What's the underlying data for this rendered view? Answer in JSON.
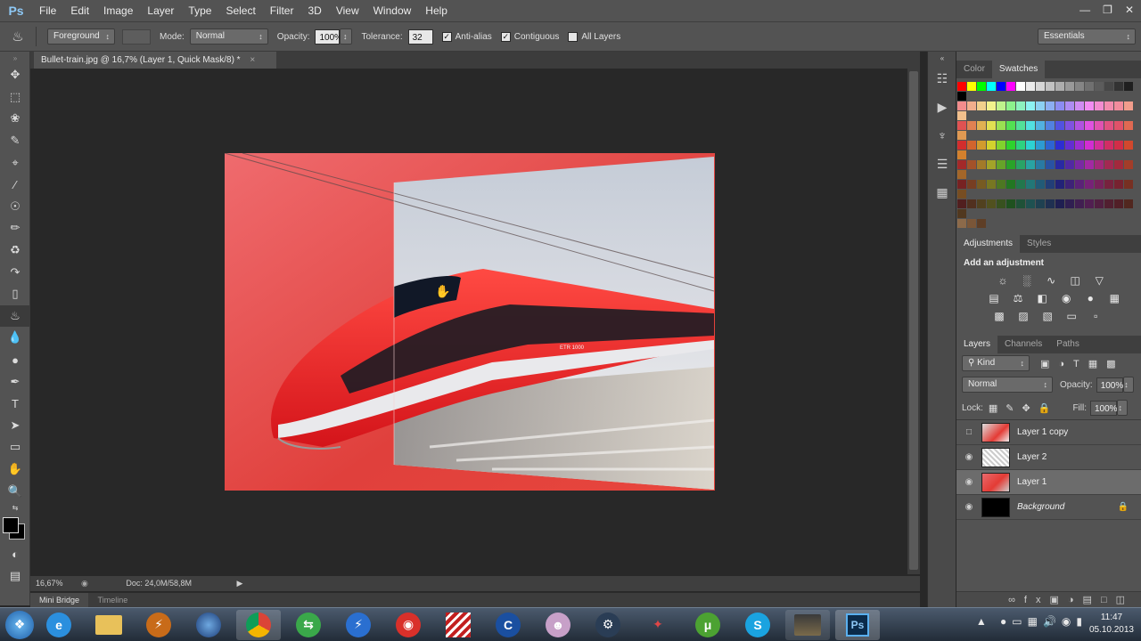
{
  "app": {
    "logo": "Ps"
  },
  "menu": [
    "File",
    "Edit",
    "Image",
    "Layer",
    "Type",
    "Select",
    "Filter",
    "3D",
    "View",
    "Window",
    "Help"
  ],
  "window_controls": {
    "minimize": "—",
    "restore": "❐",
    "close": "✕"
  },
  "options": {
    "tool_icon": "paint-bucket-icon",
    "fill_source": "Foreground",
    "mode_label": "Mode:",
    "mode": "Normal",
    "opacity_label": "Opacity:",
    "opacity": "100%",
    "tolerance_label": "Tolerance:",
    "tolerance": "32",
    "antialias": "Anti-alias",
    "contiguous": "Contiguous",
    "all_layers": "All Layers",
    "workspace": "Essentials"
  },
  "document": {
    "tab_title": "Bullet-train.jpg @ 16,7% (Layer 1, Quick Mask/8) *",
    "close": "×",
    "zoom": "16,67%",
    "doc_size": "Doc: 24,0M/58,8M",
    "artwork_text": {
      "train_label": "ETR 1000"
    }
  },
  "bottom_tabs": [
    "Mini Bridge",
    "Timeline"
  ],
  "color_panel": {
    "tabs": [
      "Color",
      "Swatches"
    ],
    "active": "Swatches"
  },
  "adjustments_panel": {
    "tabs": [
      "Adjustments",
      "Styles"
    ],
    "heading": "Add an adjustment"
  },
  "layers_panel": {
    "tabs": [
      "Layers",
      "Channels",
      "Paths"
    ],
    "kind": "Kind",
    "blend_mode": "Normal",
    "opacity_label": "Opacity:",
    "opacity": "100%",
    "lock_label": "Lock:",
    "fill_label": "Fill:",
    "fill": "100%",
    "layers": [
      {
        "name": "Layer 1 copy",
        "visible": false,
        "selected": false
      },
      {
        "name": "Layer 2",
        "visible": true,
        "selected": false
      },
      {
        "name": "Layer 1",
        "visible": true,
        "selected": true
      },
      {
        "name": "Background",
        "visible": true,
        "selected": false,
        "locked": true
      }
    ]
  },
  "taskbar": {
    "time": "11:47",
    "date": "05.10.2013",
    "apps": [
      "start-orb",
      "internet-explorer",
      "file-explorer",
      "flash",
      "google-earth",
      "chrome",
      "utility-green",
      "thunderbird-blue",
      "app-red",
      "app-stripes",
      "app-blue",
      "game-icon",
      "steam",
      "app-x",
      "utorrent",
      "skype",
      "game-cover",
      "photoshop"
    ]
  },
  "colors": {
    "accent": "#e8312c",
    "ui_dark": "#535353",
    "canvas": "#282828"
  }
}
